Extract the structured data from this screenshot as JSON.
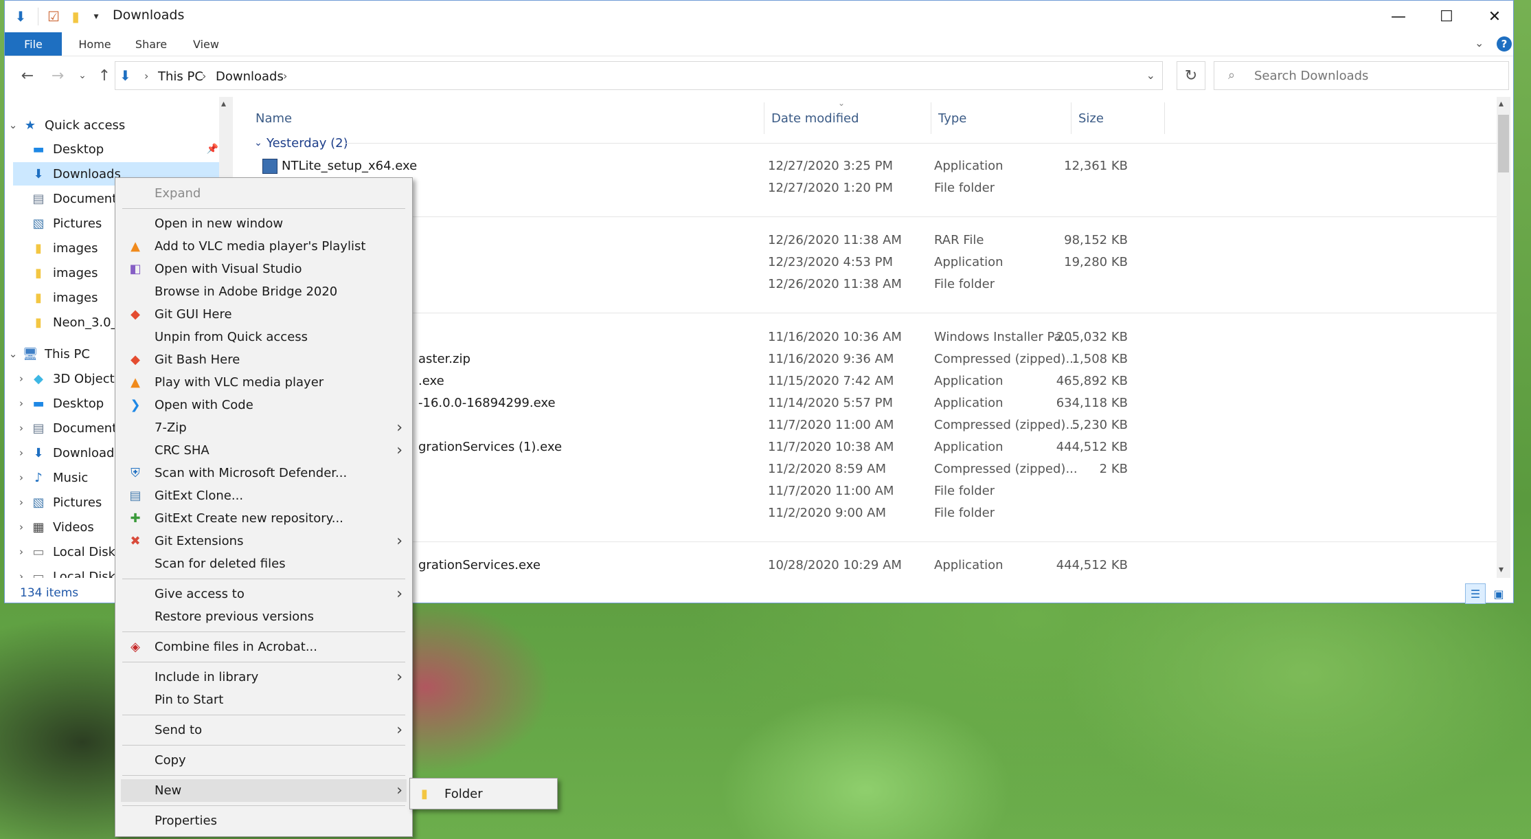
{
  "window": {
    "title": "Downloads",
    "minimize_glyph": "—",
    "maximize_glyph": "☐",
    "close_glyph": "✕"
  },
  "ribbon": {
    "tabs": [
      "File",
      "Home",
      "Share",
      "View"
    ],
    "help_glyph": "?"
  },
  "address": {
    "crumbs": [
      "This PC",
      "Downloads"
    ],
    "search_placeholder": "Search Downloads"
  },
  "nav": {
    "items": [
      {
        "label": "Quick access",
        "icon": "star-icon"
      },
      {
        "label": "Desktop",
        "icon": "desktop-icon"
      },
      {
        "label": "Downloads",
        "icon": "download-icon"
      },
      {
        "label": "Document",
        "icon": "documents-icon"
      },
      {
        "label": "Pictures",
        "icon": "pictures-icon"
      },
      {
        "label": "images",
        "icon": "folder-icon"
      },
      {
        "label": "images",
        "icon": "folder-icon"
      },
      {
        "label": "images",
        "icon": "folder-icon"
      },
      {
        "label": "Neon_3.0_",
        "icon": "folder-icon"
      },
      {
        "label": "This PC",
        "icon": "computer-icon"
      },
      {
        "label": "3D Objects",
        "icon": "3d-objects-icon"
      },
      {
        "label": "Desktop",
        "icon": "desktop-icon"
      },
      {
        "label": "Document",
        "icon": "documents-icon"
      },
      {
        "label": "Downloads",
        "icon": "download-icon"
      },
      {
        "label": "Music",
        "icon": "music-icon"
      },
      {
        "label": "Pictures",
        "icon": "pictures-icon"
      },
      {
        "label": "Videos",
        "icon": "videos-icon"
      },
      {
        "label": "Local Disk",
        "icon": "disk-icon"
      },
      {
        "label": "Local Disk",
        "icon": "disk-icon"
      }
    ]
  },
  "status": {
    "items_count": "134 items"
  },
  "columns": {
    "name": "Name",
    "date": "Date modified",
    "type": "Type",
    "size": "Size"
  },
  "groups": {
    "yesterday": "Yesterday (2)"
  },
  "rows": [
    {
      "name": "NTLite_setup_x64.exe",
      "date": "12/27/2020 3:25 PM",
      "type": "Application",
      "size": "12,361 KB"
    },
    {
      "name": "",
      "date": "12/27/2020 1:20 PM",
      "type": "File folder",
      "size": ""
    },
    {
      "name": "",
      "date": "12/26/2020 11:38 AM",
      "type": "RAR File",
      "size": "98,152 KB"
    },
    {
      "name": "",
      "date": "12/23/2020 4:53 PM",
      "type": "Application",
      "size": "19,280 KB"
    },
    {
      "name": "",
      "date": "12/26/2020 11:38 AM",
      "type": "File folder",
      "size": ""
    },
    {
      "name": "",
      "date": "11/16/2020 10:36 AM",
      "type": "Windows Installer Pa...",
      "size": "205,032 KB"
    },
    {
      "name": "aster.zip",
      "date": "11/16/2020 9:36 AM",
      "type": "Compressed (zipped)...",
      "size": "1,508 KB"
    },
    {
      "name": ".exe",
      "date": "11/15/2020 7:42 AM",
      "type": "Application",
      "size": "465,892 KB"
    },
    {
      "name": "-16.0.0-16894299.exe",
      "date": "11/14/2020 5:57 PM",
      "type": "Application",
      "size": "634,118 KB"
    },
    {
      "name": "",
      "date": "11/7/2020 11:00 AM",
      "type": "Compressed (zipped)...",
      "size": "5,230 KB"
    },
    {
      "name": "grationServices (1).exe",
      "date": "11/7/2020 10:38 AM",
      "type": "Application",
      "size": "444,512 KB"
    },
    {
      "name": "",
      "date": "11/2/2020 8:59 AM",
      "type": "Compressed (zipped)...",
      "size": "2 KB"
    },
    {
      "name": "",
      "date": "11/7/2020 11:00 AM",
      "type": "File folder",
      "size": ""
    },
    {
      "name": "",
      "date": "11/2/2020 9:00 AM",
      "type": "File folder",
      "size": ""
    },
    {
      "name": "grationServices.exe",
      "date": "10/28/2020 10:29 AM",
      "type": "Application",
      "size": "444,512 KB"
    }
  ],
  "context_menu": {
    "items": [
      {
        "label": "Expand",
        "icon": "",
        "disabled": true
      },
      {
        "label": "Open in new window",
        "icon": ""
      },
      {
        "label": "Add to VLC media player's Playlist",
        "icon": "vlc-icon"
      },
      {
        "label": "Open with Visual Studio",
        "icon": "visual-studio-icon"
      },
      {
        "label": "Browse in Adobe Bridge 2020",
        "icon": ""
      },
      {
        "label": "Git GUI Here",
        "icon": "git-gui-icon"
      },
      {
        "label": "Unpin from Quick access",
        "icon": ""
      },
      {
        "label": "Git Bash Here",
        "icon": "git-bash-icon"
      },
      {
        "label": "Play with VLC media player",
        "icon": "vlc-icon"
      },
      {
        "label": "Open with Code",
        "icon": "vscode-icon"
      },
      {
        "label": "7-Zip",
        "icon": "",
        "submenu": true
      },
      {
        "label": "CRC SHA",
        "icon": "",
        "submenu": true
      },
      {
        "label": "Scan with Microsoft Defender...",
        "icon": "defender-icon"
      },
      {
        "label": "GitExt Clone...",
        "icon": "gitext-clone-icon"
      },
      {
        "label": "GitExt Create new repository...",
        "icon": "gitext-create-icon"
      },
      {
        "label": "Git Extensions",
        "icon": "git-extensions-icon",
        "submenu": true
      },
      {
        "label": "Scan for deleted files",
        "icon": ""
      },
      {
        "label": "Give access to",
        "icon": "",
        "submenu": true
      },
      {
        "label": "Restore previous versions",
        "icon": ""
      },
      {
        "label": "Combine files in Acrobat...",
        "icon": "acrobat-icon"
      },
      {
        "label": "Include in library",
        "icon": "",
        "submenu": true
      },
      {
        "label": "Pin to Start",
        "icon": ""
      },
      {
        "label": "Send to",
        "icon": "",
        "submenu": true
      },
      {
        "label": "Copy",
        "icon": ""
      },
      {
        "label": "New",
        "icon": "",
        "submenu": true
      },
      {
        "label": "Properties",
        "icon": ""
      }
    ],
    "submenu_arrow": "›"
  },
  "new_submenu": {
    "items": [
      {
        "label": "Folder",
        "icon": "folder-icon"
      }
    ]
  },
  "colors": {
    "accent": "#1e6fc1",
    "selection": "#cce8ff",
    "folder": "#f3c642"
  }
}
